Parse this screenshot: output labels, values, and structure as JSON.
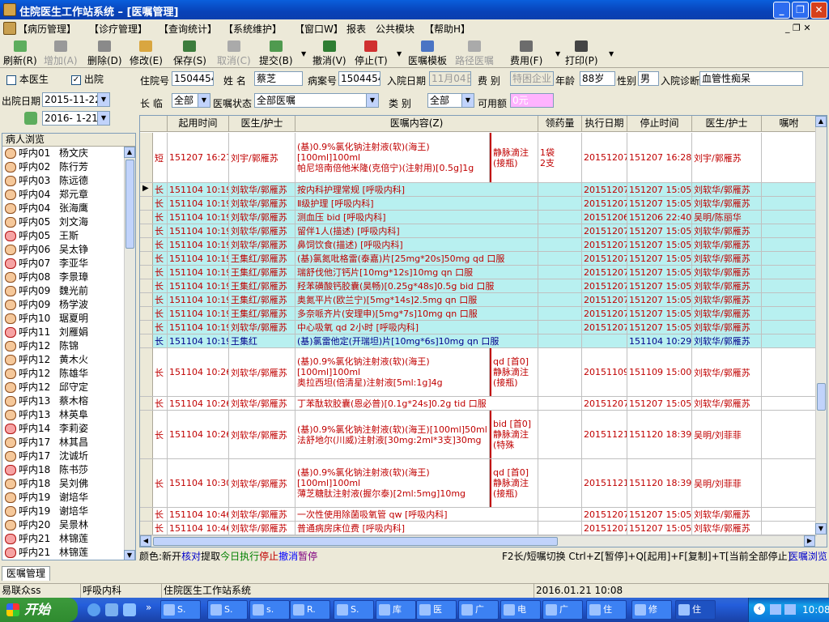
{
  "window": {
    "title": "住院医生工作站系统 – [医嘱管理]"
  },
  "menu": [
    "【病历管理】",
    "【诊疗管理】",
    "【查询统计】",
    "【系统维护】",
    "【窗口W】",
    "报表",
    "公共模块",
    "【帮助H】"
  ],
  "toolbar": [
    {
      "label": "刷新(R)",
      "icon": "refresh-icon",
      "enabled": true
    },
    {
      "label": "增加(A)",
      "icon": "add-icon",
      "enabled": false
    },
    {
      "label": "删除(D)",
      "icon": "delete-icon",
      "enabled": true
    },
    {
      "label": "修改(E)",
      "icon": "edit-icon",
      "enabled": true
    },
    {
      "label": "保存(S)",
      "icon": "save-icon",
      "enabled": true
    },
    {
      "label": "取消(C)",
      "icon": "cancel-icon",
      "enabled": false
    },
    {
      "label": "提交(B)",
      "icon": "submit-icon",
      "enabled": true
    },
    {
      "label": "撤消(V)",
      "icon": "undo-icon",
      "enabled": true
    },
    {
      "label": "停止(T)",
      "icon": "stop-icon",
      "enabled": true
    },
    {
      "label": "医嘱模板",
      "icon": "template-icon",
      "enabled": true
    },
    {
      "label": "路径医嘱",
      "icon": "pathway-icon",
      "enabled": false
    },
    {
      "label": "费用(F)",
      "icon": "fee-icon",
      "enabled": true
    },
    {
      "label": "打印(P)",
      "icon": "print-icon",
      "enabled": true
    }
  ],
  "left": {
    "chk_my": "本医生",
    "chk_out": "出院",
    "out_date_label": "出院日期",
    "date_from": "2015-11-22",
    "date_to": "2016- 1-21",
    "list_header": "病人浏览",
    "patients": [
      {
        "ward": "呼内01",
        "name": "杨文庆",
        "f": false
      },
      {
        "ward": "呼内02",
        "name": "陈行芳",
        "f": false
      },
      {
        "ward": "呼内03",
        "name": "陈远德",
        "f": false
      },
      {
        "ward": "呼内04",
        "name": "郑元章",
        "f": false
      },
      {
        "ward": "呼内04",
        "name": "张海鹰",
        "f": false
      },
      {
        "ward": "呼内05",
        "name": "刘文海",
        "f": false
      },
      {
        "ward": "呼内05",
        "name": "王斯",
        "f": true
      },
      {
        "ward": "呼内06",
        "name": "吴太铮",
        "f": false
      },
      {
        "ward": "呼内07",
        "name": "李亚华",
        "f": true
      },
      {
        "ward": "呼内08",
        "name": "李景璋",
        "f": false
      },
      {
        "ward": "呼内09",
        "name": "魏光前",
        "f": false
      },
      {
        "ward": "呼内09",
        "name": "杨学波",
        "f": false
      },
      {
        "ward": "呼内10",
        "name": "琚夏明",
        "f": false
      },
      {
        "ward": "呼内11",
        "name": "刘雁娟",
        "f": true
      },
      {
        "ward": "呼内12",
        "name": "陈锦",
        "f": false
      },
      {
        "ward": "呼内12",
        "name": "黄木火",
        "f": false
      },
      {
        "ward": "呼内12",
        "name": "陈雄华",
        "f": false
      },
      {
        "ward": "呼内12",
        "name": "邱守定",
        "f": false
      },
      {
        "ward": "呼内13",
        "name": "蔡木榕",
        "f": false
      },
      {
        "ward": "呼内13",
        "name": "林英阜",
        "f": false
      },
      {
        "ward": "呼内14",
        "name": "李莉姿",
        "f": true
      },
      {
        "ward": "呼内17",
        "name": "林其昌",
        "f": false
      },
      {
        "ward": "呼内17",
        "name": "沈诚圻",
        "f": false
      },
      {
        "ward": "呼内18",
        "name": "陈书莎",
        "f": true
      },
      {
        "ward": "呼内18",
        "name": "吴刘佛",
        "f": false
      },
      {
        "ward": "呼内19",
        "name": "谢培华",
        "f": false
      },
      {
        "ward": "呼内19",
        "name": "谢培华",
        "f": false
      },
      {
        "ward": "呼内20",
        "name": "吴景林",
        "f": false
      },
      {
        "ward": "呼内21",
        "name": "林锦莲",
        "f": true
      },
      {
        "ward": "呼内21",
        "name": "林锦莲",
        "f": true
      }
    ]
  },
  "filters": {
    "admission_no_label": "住院号",
    "admission_no": "1504454",
    "name_label": "姓  名",
    "name": "蔡芝",
    "case_no_label": "病案号",
    "case_no": "1504454",
    "admit_date_label": "入院日期",
    "admit_date": "11月04日",
    "fee_type_label": "费  别",
    "fee_type": "特困企业",
    "age_label": "年龄",
    "age": "88岁",
    "sex_label": "性别",
    "sex": "男",
    "diag_label": "入院诊断",
    "diag": "血管性痴呆",
    "longshort_label": "长  临",
    "longshort": "全部",
    "status_label": "医嘱状态",
    "status": "全部医嘱",
    "category_label": "类    别",
    "category": "全部",
    "balance_label": "可用额",
    "balance": "0元"
  },
  "grid": {
    "columns": [
      "起用时间",
      "医生/护士",
      "医嘱内容(Z)",
      "领药量",
      "执行日期",
      "停止时间",
      "医生/护士",
      "嘱咐"
    ],
    "rows": [
      {
        "type": "短",
        "start": "151207 16:27",
        "doc": "刘宇/郭雁苏",
        "content": "(基)0.9%氯化钠注射液(软)(海王)[100ml]100ml\n帕尼培南倍他米隆(克倍宁)(注射用)[0.5g]1g",
        "route": "静脉滴注(接瓶)",
        "qty": "1袋\n2支",
        "exec": "20151207",
        "stop": "151207 16:28",
        "doc2": "刘宇/郭雁苏",
        "cy": false,
        "h": 62
      },
      {
        "type": "长",
        "start": "151104 10:19",
        "doc": "刘软华/郭雁苏",
        "content": "按内科护理常规   [呼吸内科]",
        "route": "",
        "qty": "",
        "exec": "20151207",
        "stop": "151207 15:05",
        "doc2": "刘软华/郭雁苏",
        "cy": true,
        "h": 17,
        "cur": true
      },
      {
        "type": "长",
        "start": "151104 10:19",
        "doc": "刘软华/郭雁苏",
        "content": "Ⅱ级护理   [呼吸内科]",
        "route": "",
        "qty": "",
        "exec": "20151207",
        "stop": "151207 15:05",
        "doc2": "刘软华/郭雁苏",
        "cy": true,
        "h": 17
      },
      {
        "type": "长",
        "start": "151104 10:19",
        "doc": "刘软华/郭雁苏",
        "content": "测血压 bid  [呼吸内科]",
        "route": "",
        "qty": "",
        "exec": "20151206",
        "stop": "151206 22:40",
        "doc2": "吴明/陈丽华",
        "cy": true,
        "h": 17
      },
      {
        "type": "长",
        "start": "151104 10:19",
        "doc": "刘软华/郭雁苏",
        "content": "留伴1人(描述)   [呼吸内科]",
        "route": "",
        "qty": "",
        "exec": "20151207",
        "stop": "151207 15:05",
        "doc2": "刘软华/郭雁苏",
        "cy": true,
        "h": 17
      },
      {
        "type": "长",
        "start": "151104 10:19",
        "doc": "刘软华/郭雁苏",
        "content": "鼻饲饮食(描述)   [呼吸内科]",
        "route": "",
        "qty": "",
        "exec": "20151207",
        "stop": "151207 15:05",
        "doc2": "刘软华/郭雁苏",
        "cy": true,
        "h": 17
      },
      {
        "type": "长",
        "start": "151104 10:19",
        "doc": "王集红/郭雁苏",
        "content": "(基)氯氮吡格雷(泰嘉)片[25mg*20s]50mg qd 口服",
        "route": "",
        "qty": "",
        "exec": "20151207",
        "stop": "151207 15:05",
        "doc2": "刘软华/郭雁苏",
        "cy": true,
        "h": 17
      },
      {
        "type": "长",
        "start": "151104 10:19",
        "doc": "王集红/郭雁苏",
        "content": "瑞舒伐他汀钙片[10mg*12s]10mg qn 口服",
        "route": "",
        "qty": "",
        "exec": "20151207",
        "stop": "151207 15:05",
        "doc2": "刘软华/郭雁苏",
        "cy": true,
        "h": 17
      },
      {
        "type": "长",
        "start": "151104 10:19",
        "doc": "王集红/郭雁苏",
        "content": "羟苯磺酸钙胶囊(昊畅)[0.25g*48s]0.5g bid 口服",
        "route": "",
        "qty": "",
        "exec": "20151207",
        "stop": "151207 15:05",
        "doc2": "刘软华/郭雁苏",
        "cy": true,
        "h": 17
      },
      {
        "type": "长",
        "start": "151104 10:19",
        "doc": "王集红/郭雁苏",
        "content": "奥氮平片(欧兰宁)[5mg*14s]2.5mg qn 口服",
        "route": "",
        "qty": "",
        "exec": "20151207",
        "stop": "151207 15:05",
        "doc2": "刘软华/郭雁苏",
        "cy": true,
        "h": 17
      },
      {
        "type": "长",
        "start": "151104 10:19",
        "doc": "王集红/郭雁苏",
        "content": "多奈哌齐片(安理申)[5mg*7s]10mg qn 口服",
        "route": "",
        "qty": "",
        "exec": "20151207",
        "stop": "151207 15:05",
        "doc2": "刘软华/郭雁苏",
        "cy": true,
        "h": 17
      },
      {
        "type": "长",
        "start": "151104 10:19",
        "doc": "刘软华/郭雁苏",
        "content": "中心吸氧 qd 2小时   [呼吸内科]",
        "route": "",
        "qty": "",
        "exec": "20151207",
        "stop": "151207 15:05",
        "doc2": "刘软华/郭雁苏",
        "cy": true,
        "h": 17
      },
      {
        "type": "长",
        "start": "151104 10:19",
        "doc": "王集红",
        "content": "(基)氯雷他定(开瑞坦)片[10mg*6s]10mg qn 口服",
        "route": "",
        "qty": "",
        "exec": "",
        "stop": "151104 10:29",
        "doc2": "刘软华/郭雁苏",
        "cy": true,
        "h": 17,
        "blue": true
      },
      {
        "type": "长",
        "start": "151104 10:26",
        "doc": "刘软华/郭雁苏",
        "content": "(基)0.9%氯化钠注射液(软)(海王)[100ml]100ml\n奥拉西坦(倍清星)注射液[5ml:1g]4g",
        "route": "qd [首0]静脉滴注(接瓶)",
        "qty": "",
        "exec": "20151109",
        "stop": "151109 15:00",
        "doc2": "刘软华/郭雁苏",
        "cy": false,
        "h": 60
      },
      {
        "type": "长",
        "start": "151104 10:26",
        "doc": "刘软华/郭雁苏",
        "content": "丁苯酞软胶囊(恩必普)[0.1g*24s]0.2g tid 口服",
        "route": "",
        "qty": "",
        "exec": "20151207",
        "stop": "151207 15:05",
        "doc2": "刘软华/郭雁苏",
        "cy": false,
        "h": 17
      },
      {
        "type": "长",
        "start": "151104 10:26",
        "doc": "刘软华/郭雁苏",
        "content": "(基)0.9%氯化钠注射液(软)(海王)[100ml]50ml\n法舒地尔(川威)注射液[30mg:2ml*3支]30mg",
        "route": "bid [首0]静脉滴注(特殊",
        "qty": "",
        "exec": "20151121",
        "stop": "151120 18:39",
        "doc2": "吴明/刘菲菲",
        "cy": false,
        "h": 60
      },
      {
        "type": "长",
        "start": "151104 10:30",
        "doc": "刘软华/郭雁苏",
        "content": "(基)0.9%氯化钠注射液(软)(海王)[100ml]100ml\n薄芝糖肽注射液(握尔泰)[2ml:5mg]10mg",
        "route": "qd [首0]静脉滴注(接瓶)",
        "qty": "",
        "exec": "20151121",
        "stop": "151120 18:39",
        "doc2": "吴明/刘菲菲",
        "cy": false,
        "h": 60
      },
      {
        "type": "长",
        "start": "151104 10:46",
        "doc": "刘软华/郭雁苏",
        "content": "一次性使用除菌吸氧管  qw  [呼吸内科]",
        "route": "",
        "qty": "",
        "exec": "20151207",
        "stop": "151207 15:05",
        "doc2": "刘软华/郭雁苏",
        "cy": false,
        "h": 17
      },
      {
        "type": "长",
        "start": "151104 10:46",
        "doc": "刘软华/郭雁苏",
        "content": "普通病房床位费   [呼吸内科]",
        "route": "",
        "qty": "",
        "exec": "20151207",
        "stop": "151207 15:05",
        "doc2": "刘软华/郭雁苏",
        "cy": false,
        "h": 17
      }
    ]
  },
  "legend": {
    "prefix": "颜色:",
    "items": [
      {
        "t": "新开",
        "c": "#000000"
      },
      {
        "t": "核对",
        "c": "#0000cc"
      },
      {
        "t": "提取",
        "c": "#000000"
      },
      {
        "t": "今日执行",
        "c": "#008000"
      },
      {
        "t": "停止",
        "c": "#c00000"
      },
      {
        "t": "撤消",
        "c": "#0000ff"
      },
      {
        "t": "暂停",
        "c": "#800080"
      }
    ],
    "hint": "F2长/短嘱切换 Ctrl+Z[暂停]+Q[起用]+F[复制]+T[当前全部停止]",
    "link": "医嘱浏览"
  },
  "tab": "医嘱管理",
  "status": {
    "user": "易联众ss",
    "dept": "呼吸内科",
    "system": "住院医生工作站系统",
    "datetime": "2016.01.21 10:08"
  },
  "taskbar": {
    "start": "开始",
    "time": "10:08",
    "items": [
      "S.",
      "S.",
      "s.",
      "R.",
      "S.",
      "库",
      "医",
      "广",
      "电",
      "广",
      "住",
      "修",
      "住"
    ]
  }
}
